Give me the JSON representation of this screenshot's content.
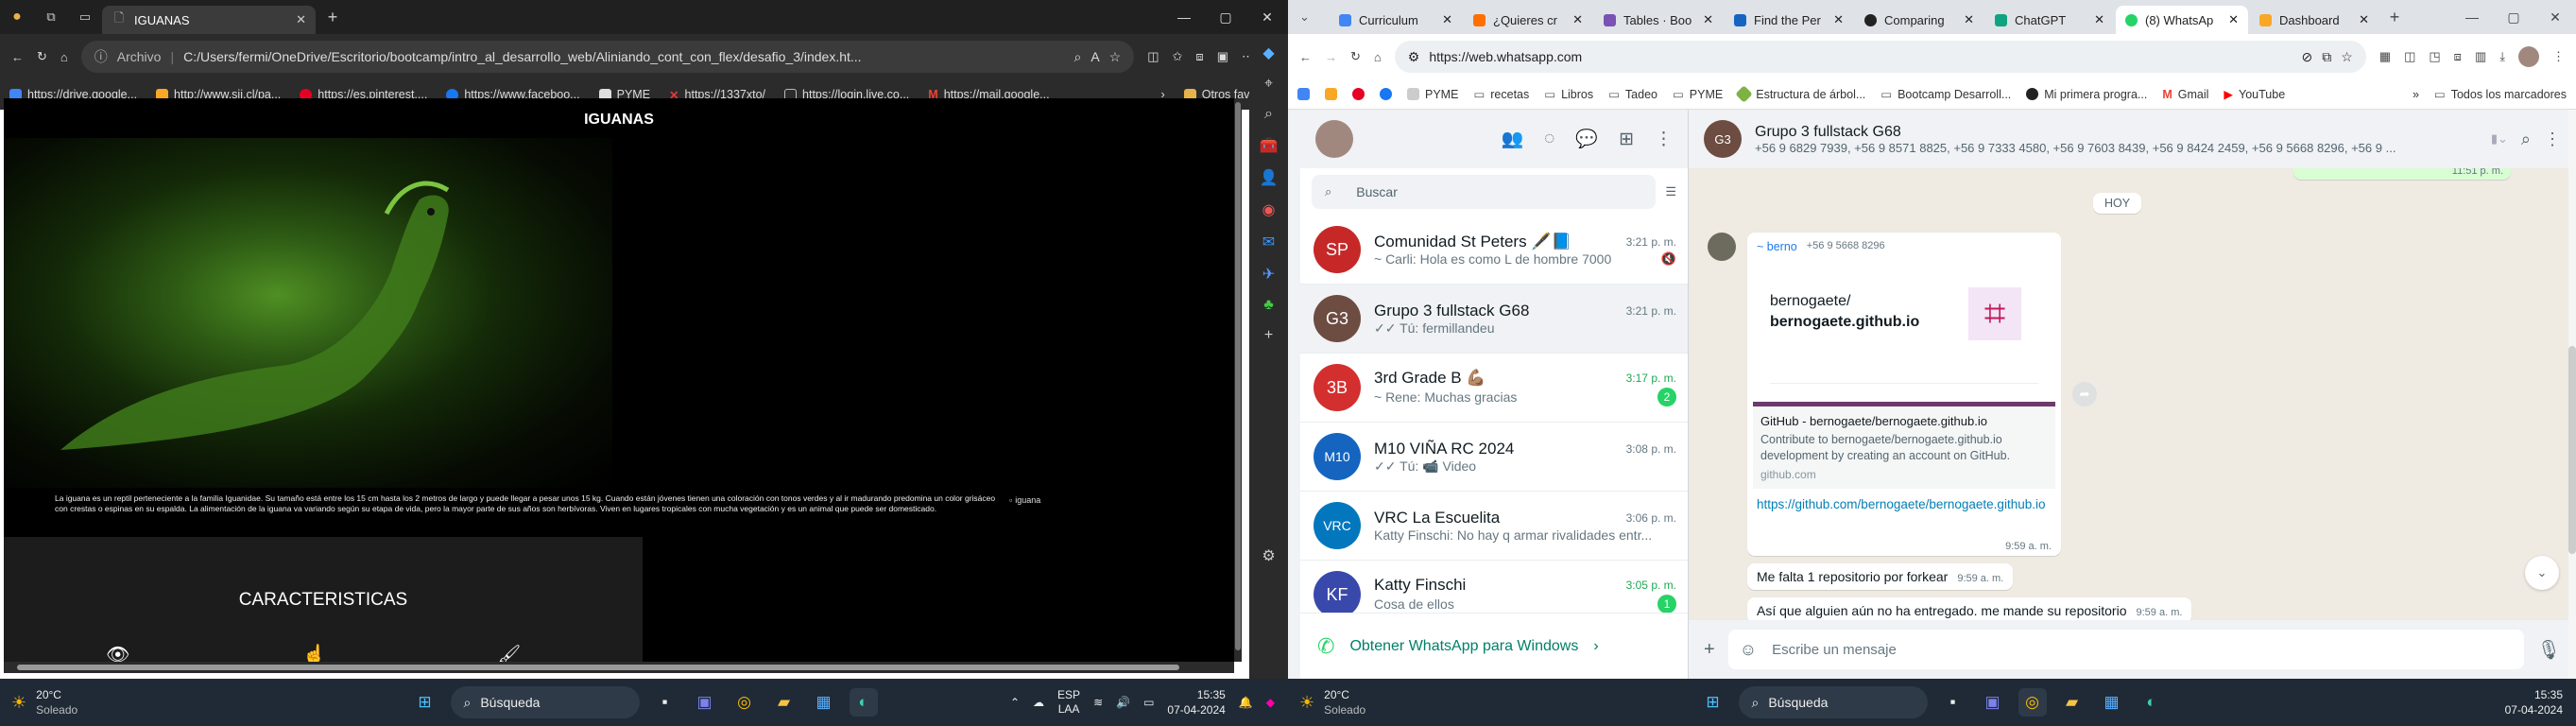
{
  "left": {
    "tab": {
      "title": "IGUANAS"
    },
    "address": {
      "prefix": "Archivo",
      "url": "C:/Users/fermi/OneDrive/Escritorio/bootcamp/intro_al_desarrollo_web/Aliniando_cont_con_flex/desafio_3/index.ht..."
    },
    "bookmarks": [
      "https://drive.google...",
      "http://www.sii.cl/pa...",
      "https://es.pinterest....",
      "https://www.faceboo...",
      "PYME",
      "https://1337xto/",
      "https://login.live.co...",
      "https://mail.google..."
    ],
    "bookmarks_other": "Otros favoritos",
    "page": {
      "heading": "IGUANAS",
      "paragraph": "La iguana es un reptil perteneciente a la familia Iguanidae. Su tamaño está entre los 15 cm hasta los 2 metros de largo y puede llegar a pesar unos 15 kg. Cuando están jóvenes tienen una coloración con tonos verdes y al ir madurando predomina un color grisáceo con crestas o espinas en su espalda. La alimentación de la iguana va variando según su etapa de vida, pero la mayor parte de sus años son herbívoras. Viven en lugares tropicales con mucha vegetación y es un animal que puede ser domesticado.",
      "img_alt": "iguana",
      "section_title": "CARACTERISTICAS"
    },
    "taskbar": {
      "temp": "20°C",
      "weather": "Soleado",
      "search": "Búsqueda",
      "lang1": "ESP",
      "lang2": "LAA",
      "time": "15:35",
      "date": "07-04-2024"
    }
  },
  "right": {
    "tabs": [
      "Curriculum",
      "¿Quieres cr",
      "Tables · Boo",
      "Find the Per",
      "Comparing",
      "ChatGPT",
      "(8) WhatsAp",
      "Dashboard"
    ],
    "address": {
      "url": "https://web.whatsapp.com"
    },
    "bookmarks": [
      "PYME",
      "recetas",
      "Libros",
      "Tadeo",
      "PYME",
      "Estructura de árbol...",
      "Bootcamp Desarroll...",
      "Mi primera progra...",
      "Gmail",
      "YouTube"
    ],
    "bookmarks_all": "Todos los marcadores",
    "search_placeholder": "Buscar",
    "chats": [
      {
        "name": "Comunidad St Peters 🖋️📘",
        "time": "3:21 p. m.",
        "preview": "~ Carli: Hola es como L de hombre 7000",
        "badge": "",
        "color": "#c62828",
        "initials": "SP"
      },
      {
        "name": "Grupo 3 fullstack G68",
        "time": "3:21 p. m.",
        "preview": "✓✓ Tú: fermillandeu",
        "badge": "",
        "color": "#6d4c41",
        "initials": "G3"
      },
      {
        "name": "3rd Grade B 💪🏽",
        "time": "3:17 p. m.",
        "preview": "~ Rene: Muchas gracias",
        "badge": "2",
        "color": "#d32f2f",
        "initials": "3B"
      },
      {
        "name": "M10 VIÑA RC 2024",
        "time": "3:08 p. m.",
        "preview": "✓✓ Tú: 📹 Video",
        "badge": "",
        "color": "#1565c0",
        "initials": "M10"
      },
      {
        "name": "VRC La Escuelita",
        "time": "3:06 p. m.",
        "preview": "Katty Finschi: No hay q armar rivalidades entr...",
        "badge": "",
        "color": "#0277bd",
        "initials": "VRC"
      },
      {
        "name": "Katty Finschi",
        "time": "3:05 p. m.",
        "preview": "Cosa de ellos",
        "badge": "1",
        "color": "#3949ab",
        "initials": "KF"
      }
    ],
    "get_app": "Obtener WhatsApp para Windows",
    "conversation": {
      "title": "Grupo 3 fullstack G68",
      "members": "+56 9 6829 7939, +56 9 8571 8825, +56 9 7333 4580, +56 9 7603 8439, +56 9 8424 2459, +56 9 5668 8296, +56 9 ...",
      "top_time": "11:51 p. m.",
      "day": "HOY",
      "sender": "~ berno",
      "sender_phone": "+56 9 5668 8296",
      "preview_path": "bernogaete/",
      "preview_title": "bernogaete.github.io",
      "link_title": "GitHub - bernogaete/bernogaete.github.io",
      "link_desc": "Contribute to bernogaete/bernogaete.github.io development by creating an account on GitHub.",
      "link_domain": "github.com",
      "link_url": "https://github.com/bernogaete/bernogaete.github.io",
      "link_time": "9:59 a. m.",
      "msg2": "Me falta 1 repositorio por forkear",
      "msg2_time": "9:59 a. m.",
      "msg3": "Así que alguien aún no ha entregado. me mande su repositorio",
      "msg3_time": "9:59 a. m.",
      "input_placeholder": "Escribe un mensaje"
    },
    "taskbar": {
      "temp": "20°C",
      "weather": "Soleado",
      "search": "Búsqueda",
      "time": "15:35",
      "date": "07-04-2024"
    }
  }
}
